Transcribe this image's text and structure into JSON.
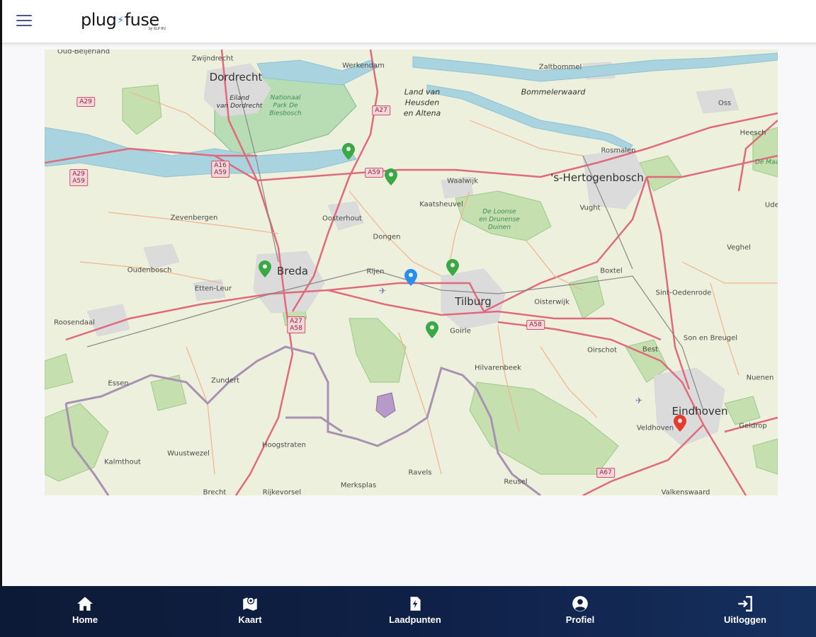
{
  "header": {
    "menu_icon": "hamburger-icon",
    "logo_part1": "plug",
    "logo_part2": "fuse",
    "logo_tagline": "by XLP BV"
  },
  "map": {
    "cities": [
      {
        "name": "Dordrecht"
      },
      {
        "name": "Breda"
      },
      {
        "name": "Tilburg"
      },
      {
        "name": "'s-Hertogenbosch"
      },
      {
        "name": "Eindhoven"
      }
    ],
    "towns": [
      {
        "name": "Zwijndrecht"
      },
      {
        "name": "Werkendam"
      },
      {
        "name": "Zaltbommel"
      },
      {
        "name": "Oss"
      },
      {
        "name": "Rosmalen"
      },
      {
        "name": "Waalwijk"
      },
      {
        "name": "Kaatsheuvel"
      },
      {
        "name": "Oosterhout"
      },
      {
        "name": "Dongen"
      },
      {
        "name": "Zevenbergen"
      },
      {
        "name": "Oudenbosch"
      },
      {
        "name": "Etten-Leur"
      },
      {
        "name": "Rijen"
      },
      {
        "name": "Roosendaal"
      },
      {
        "name": "Oisterwijk"
      },
      {
        "name": "Boxtel"
      },
      {
        "name": "Vught"
      },
      {
        "name": "Sint-Oedenrode"
      },
      {
        "name": "Veghel"
      },
      {
        "name": "Son en Breugel"
      },
      {
        "name": "Best"
      },
      {
        "name": "Oirschot"
      },
      {
        "name": "Nuenen"
      },
      {
        "name": "Geldrop"
      },
      {
        "name": "Veldhoven"
      },
      {
        "name": "Hilvarenbeek"
      },
      {
        "name": "Goirle"
      },
      {
        "name": "Zundert"
      },
      {
        "name": "Essen"
      },
      {
        "name": "Wuustwezel"
      },
      {
        "name": "Kalmthout"
      },
      {
        "name": "Hoogstraten"
      },
      {
        "name": "Merksplas"
      },
      {
        "name": "Ravels"
      },
      {
        "name": "Reusel"
      },
      {
        "name": "Valkenswaard"
      },
      {
        "name": "Brecht"
      },
      {
        "name": "Rijkevorsel"
      },
      {
        "name": "Uden"
      },
      {
        "name": "Oud-Beijerland"
      },
      {
        "name": "Heesch"
      }
    ],
    "regions": [
      {
        "name": "Land van\nHeusden\nen Altena"
      },
      {
        "name": "Bommelerwaard"
      },
      {
        "name": "Eiland\nvan Dordrecht"
      }
    ],
    "nature": [
      {
        "name": "De Loonse\nen Drunense\nDuinen"
      },
      {
        "name": "Nationaal\nPark De\nBiesbosch"
      },
      {
        "name": "De Maa"
      }
    ],
    "roads": [
      "A29",
      "A29\nA59",
      "A16\nA59",
      "A27",
      "A59",
      "A27\nA58",
      "A58",
      "A67"
    ],
    "pins": [
      {
        "name": "charging-point-pin",
        "status": "available",
        "color": "#3aa844"
      },
      {
        "name": "charging-point-pin",
        "status": "available",
        "color": "#3aa844"
      },
      {
        "name": "charging-point-pin",
        "status": "available",
        "color": "#3aa844"
      },
      {
        "name": "charging-point-pin",
        "status": "available",
        "color": "#3aa844"
      },
      {
        "name": "charging-point-pin",
        "status": "available",
        "color": "#3aa844"
      },
      {
        "name": "current-location-pin",
        "status": "current",
        "color": "#2a8ef0"
      },
      {
        "name": "charging-point-pin",
        "status": "occupied",
        "color": "#e53b2f"
      }
    ]
  },
  "bottom_nav": {
    "items": [
      {
        "label": "Home",
        "icon": "home-icon"
      },
      {
        "label": "Kaart",
        "icon": "map-icon"
      },
      {
        "label": "Laadpunten",
        "icon": "charging-station-icon"
      },
      {
        "label": "Profiel",
        "icon": "profile-icon"
      },
      {
        "label": "Uitloggen",
        "icon": "logout-icon"
      }
    ]
  },
  "colors": {
    "nav_background": "#0f2148",
    "accent_blue": "#2a6fdb",
    "pin_available": "#3aa844",
    "pin_current": "#2a8ef0",
    "pin_occupied": "#e53b2f"
  }
}
